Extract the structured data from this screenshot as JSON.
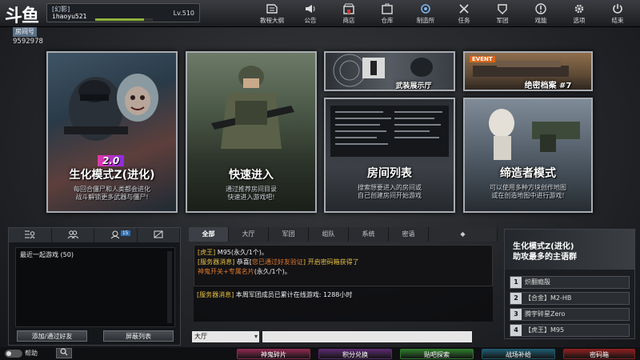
{
  "logo_text": "斗鱼",
  "profile": {
    "clan": "[幻影]",
    "username": "ihaoyu521",
    "level": "Lv.510",
    "exp_fraction": 0.85
  },
  "nav": [
    {
      "label": "教程大纲",
      "icon": "graduation-cap-icon"
    },
    {
      "label": "公告",
      "icon": "speaker-icon"
    },
    {
      "label": "商店",
      "icon": "shop-icon"
    },
    {
      "label": "仓库",
      "icon": "warehouse-icon"
    },
    {
      "label": "制造所",
      "icon": "factory-icon"
    },
    {
      "label": "任务",
      "icon": "task-icon"
    },
    {
      "label": "军团",
      "icon": "legion-icon"
    },
    {
      "label": "戏能",
      "icon": "alert-icon"
    },
    {
      "label": "选项",
      "icon": "gear-icon"
    },
    {
      "label": "结束",
      "icon": "power-icon"
    }
  ],
  "room": {
    "label": "房间号",
    "number": "9592978"
  },
  "cards": {
    "zombie": {
      "badge": "2.0",
      "title": "生化模式Z(进化)",
      "desc1": "每回合僵尸和人类都会进化",
      "desc2": "战斗解锁更多武器与僵尸!"
    },
    "quick": {
      "title": "快速进入",
      "desc1": "通过推荐房间目录",
      "desc2": "快速进入游戏吧!"
    },
    "weapon": {
      "title": "武装展示厅"
    },
    "archive": {
      "tag": "EVENT",
      "title": "绝密档案 #7"
    },
    "rooms": {
      "title": "房间列表",
      "desc1": "搜索想要进入的房间或",
      "desc2": "自己创建房间开始游戏"
    },
    "creator": {
      "title": "缔造者模式",
      "desc1": "可以使用多种方块创作地图",
      "desc2": "或在创造地图中进行游戏!"
    }
  },
  "social": {
    "tab_count": "15",
    "recent_label": "最近一起游戏 (50)",
    "add_friend": "添加/通过好友",
    "block_list": "屏蔽列表"
  },
  "chat": {
    "tabs": [
      "全部",
      "大厅",
      "军团",
      "组队",
      "系统",
      "密语"
    ],
    "messages": [
      {
        "a": "[虎王]",
        "b": " M95(永久/1个)。"
      },
      {
        "a": "[服务器消息]",
        "b": " 恭喜[",
        "c": "您已通过好友验证",
        "d": "] 开启密码箱获得了"
      },
      {
        "a": "神鬼开关+专属名片",
        "b": "(永久/1个)。"
      },
      {
        "a": "[服务器消息]",
        "b": " 本周军团成员已累计在线游戏: 1288小时"
      }
    ],
    "channel": "大厅"
  },
  "promo": {
    "line1": "生化模式Z(进化)",
    "line2": "助攻最多的主语群",
    "ranks": [
      {
        "n": "1",
        "name": "炽翻瘾殷"
      },
      {
        "n": "2",
        "name": "【合金】M2-HB"
      },
      {
        "n": "3",
        "name": "腾宇碎星Zero"
      },
      {
        "n": "4",
        "name": "【虎王】M95"
      }
    ]
  },
  "bottom": {
    "help": "帮助",
    "buttons": [
      {
        "label": "神鬼碎片",
        "color": "#8a2a4e"
      },
      {
        "label": "积分兑换",
        "color": "#5a2a6e"
      },
      {
        "label": "贴吧探索",
        "color": "#2f7a2c"
      },
      {
        "label": "战场补给",
        "color": "#1f5a6e"
      },
      {
        "label": "密码箱",
        "color": "#8a1f1f"
      }
    ]
  }
}
